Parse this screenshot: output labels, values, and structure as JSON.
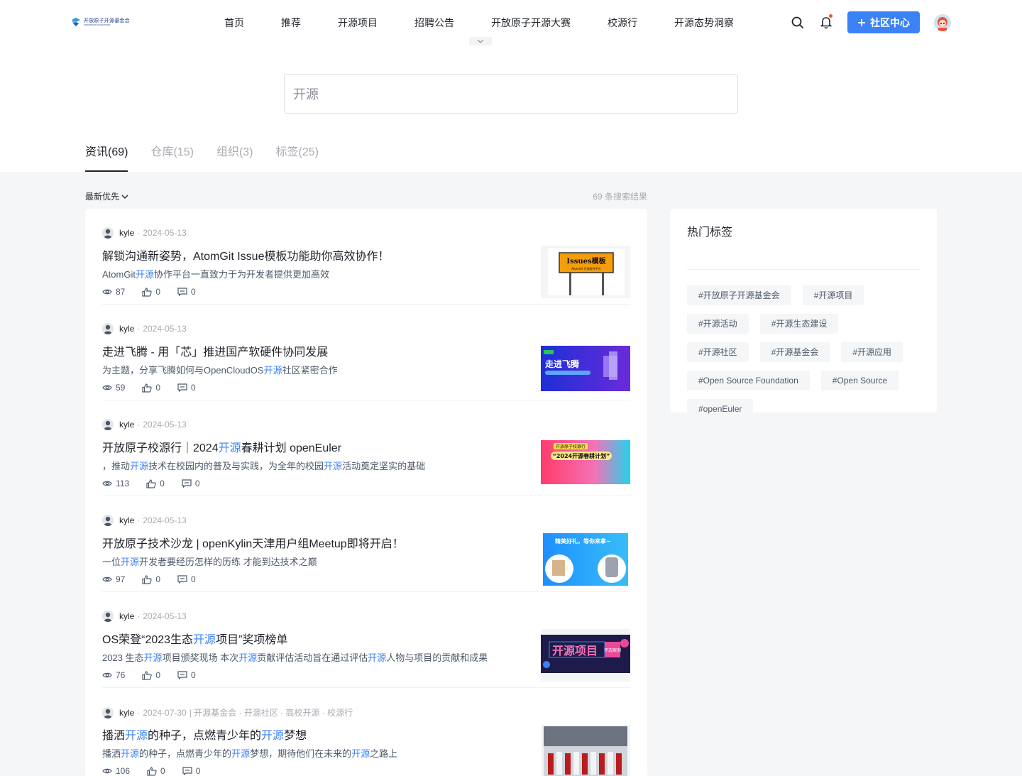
{
  "header": {
    "logo_cn": "开放原子开源基金会",
    "logo_en": "OPENATOM FOUNDATION",
    "nav": [
      "首页",
      "推荐",
      "开源项目",
      "招聘公告",
      "开放原子开源大赛",
      "校源行",
      "开源态势洞察"
    ],
    "community_button": "社区中心"
  },
  "search": {
    "value": "开源"
  },
  "tabs": [
    "资讯(69)",
    "仓库(15)",
    "组织(3)",
    "标签(25)"
  ],
  "sort_label": "最新优先",
  "result_count": "69 条搜索结果",
  "articles": [
    {
      "author": "kyle",
      "date": "2024-05-13",
      "tags_line": "",
      "title": [
        {
          "t": "解锁沟通新姿势，AtomGit Issue模板功能助你高效协作！",
          "h": false
        }
      ],
      "desc": [
        {
          "t": "AtomGit",
          "h": false
        },
        {
          "t": "开源",
          "h": true
        },
        {
          "t": "协作平台一直致力于为开发者提供更加高效",
          "h": false
        }
      ],
      "views": "87",
      "likes": "0",
      "comments": "0",
      "thumb_sign": "Issues模板",
      "thumb_sub": "AtomGit 开源协作平台"
    },
    {
      "author": "kyle",
      "date": "2024-05-13",
      "tags_line": "",
      "title": [
        {
          "t": "走进飞腾 - 用「芯」推进国产软硬件协同发展",
          "h": false
        }
      ],
      "desc": [
        {
          "t": "为主题，分享飞腾如何与OpenCloudOS",
          "h": false
        },
        {
          "t": "开源",
          "h": true
        },
        {
          "t": "社区紧密合作",
          "h": false
        }
      ],
      "views": "59",
      "likes": "0",
      "comments": "0",
      "thumb_sign": "走进飞腾",
      "thumb_sub": ""
    },
    {
      "author": "kyle",
      "date": "2024-05-13",
      "tags_line": "",
      "title": [
        {
          "t": "开放原子校源行｜2024",
          "h": false
        },
        {
          "t": "开源",
          "h": true
        },
        {
          "t": "春耕计划 openEuler",
          "h": false
        }
      ],
      "desc": [
        {
          "t": "，推动",
          "h": false
        },
        {
          "t": "开源",
          "h": true
        },
        {
          "t": "技术在校园内的普及与实践，为全年的校园",
          "h": false
        },
        {
          "t": "开源",
          "h": true
        },
        {
          "t": "活动奠定坚实的基础",
          "h": false
        }
      ],
      "views": "113",
      "likes": "0",
      "comments": "0",
      "thumb_sign": "“2024开源春耕计划”",
      "thumb_sub": "开放原子校源行"
    },
    {
      "author": "kyle",
      "date": "2024-05-13",
      "tags_line": "",
      "title": [
        {
          "t": "开放原子技术沙龙 | openKylin天津用户组Meetup即将开启！",
          "h": false
        }
      ],
      "desc": [
        {
          "t": "一位",
          "h": false
        },
        {
          "t": "开源",
          "h": true
        },
        {
          "t": "开发者要经历怎样的历练 才能到达技术之巅",
          "h": false
        }
      ],
      "views": "97",
      "likes": "0",
      "comments": "0",
      "thumb_sign": "精美好礼，等你来拿~",
      "thumb_sub": ""
    },
    {
      "author": "kyle",
      "date": "2024-05-13",
      "tags_line": "",
      "title": [
        {
          "t": "OS荣登“2023生态",
          "h": false
        },
        {
          "t": "开源",
          "h": true
        },
        {
          "t": "项目”奖项榜单",
          "h": false
        }
      ],
      "desc": [
        {
          "t": "2023 生态",
          "h": false
        },
        {
          "t": "开源",
          "h": true
        },
        {
          "t": "项目颁奖现场 本次",
          "h": false
        },
        {
          "t": "开源",
          "h": true
        },
        {
          "t": "贡献评估活动旨在通过评估",
          "h": false
        },
        {
          "t": "开源",
          "h": true
        },
        {
          "t": "人物与项目的贡献和成果",
          "h": false
        }
      ],
      "views": "76",
      "likes": "0",
      "comments": "0",
      "thumb_sign": "开源项目",
      "thumb_sub": "评选案例"
    },
    {
      "author": "kyle",
      "date": "2024-07-30",
      "tags_line": "| 开源基金会 · 开源社区 · 高校开源 · 校源行",
      "title": [
        {
          "t": "播洒",
          "h": false
        },
        {
          "t": "开源",
          "h": true
        },
        {
          "t": "的种子，点燃青少年的",
          "h": false
        },
        {
          "t": "开源",
          "h": true
        },
        {
          "t": "梦想",
          "h": false
        }
      ],
      "desc": [
        {
          "t": "播洒",
          "h": false
        },
        {
          "t": "开源",
          "h": true
        },
        {
          "t": "的种子，点燃青少年的",
          "h": false
        },
        {
          "t": "开源",
          "h": true
        },
        {
          "t": "梦想，期待他们在未来的",
          "h": false
        },
        {
          "t": "开源",
          "h": true
        },
        {
          "t": "之路上",
          "h": false
        }
      ],
      "views": "106",
      "likes": "0",
      "comments": "0",
      "thumb_sign": "",
      "thumb_sub": ""
    }
  ],
  "hot_tags": {
    "title": "热门标签",
    "tags": [
      "#开放原子开源基金会",
      "#开源项目",
      "#开源活动",
      "#开源生态建设",
      "#开源社区",
      "#开源基金会",
      "#开源应用",
      "#Open Source Foundation",
      "#Open Source",
      "#openEuler"
    ]
  },
  "colors": {
    "accent": "#3b82f6",
    "highlight": "#3b82f6",
    "notification_dot": "#f5523b"
  }
}
